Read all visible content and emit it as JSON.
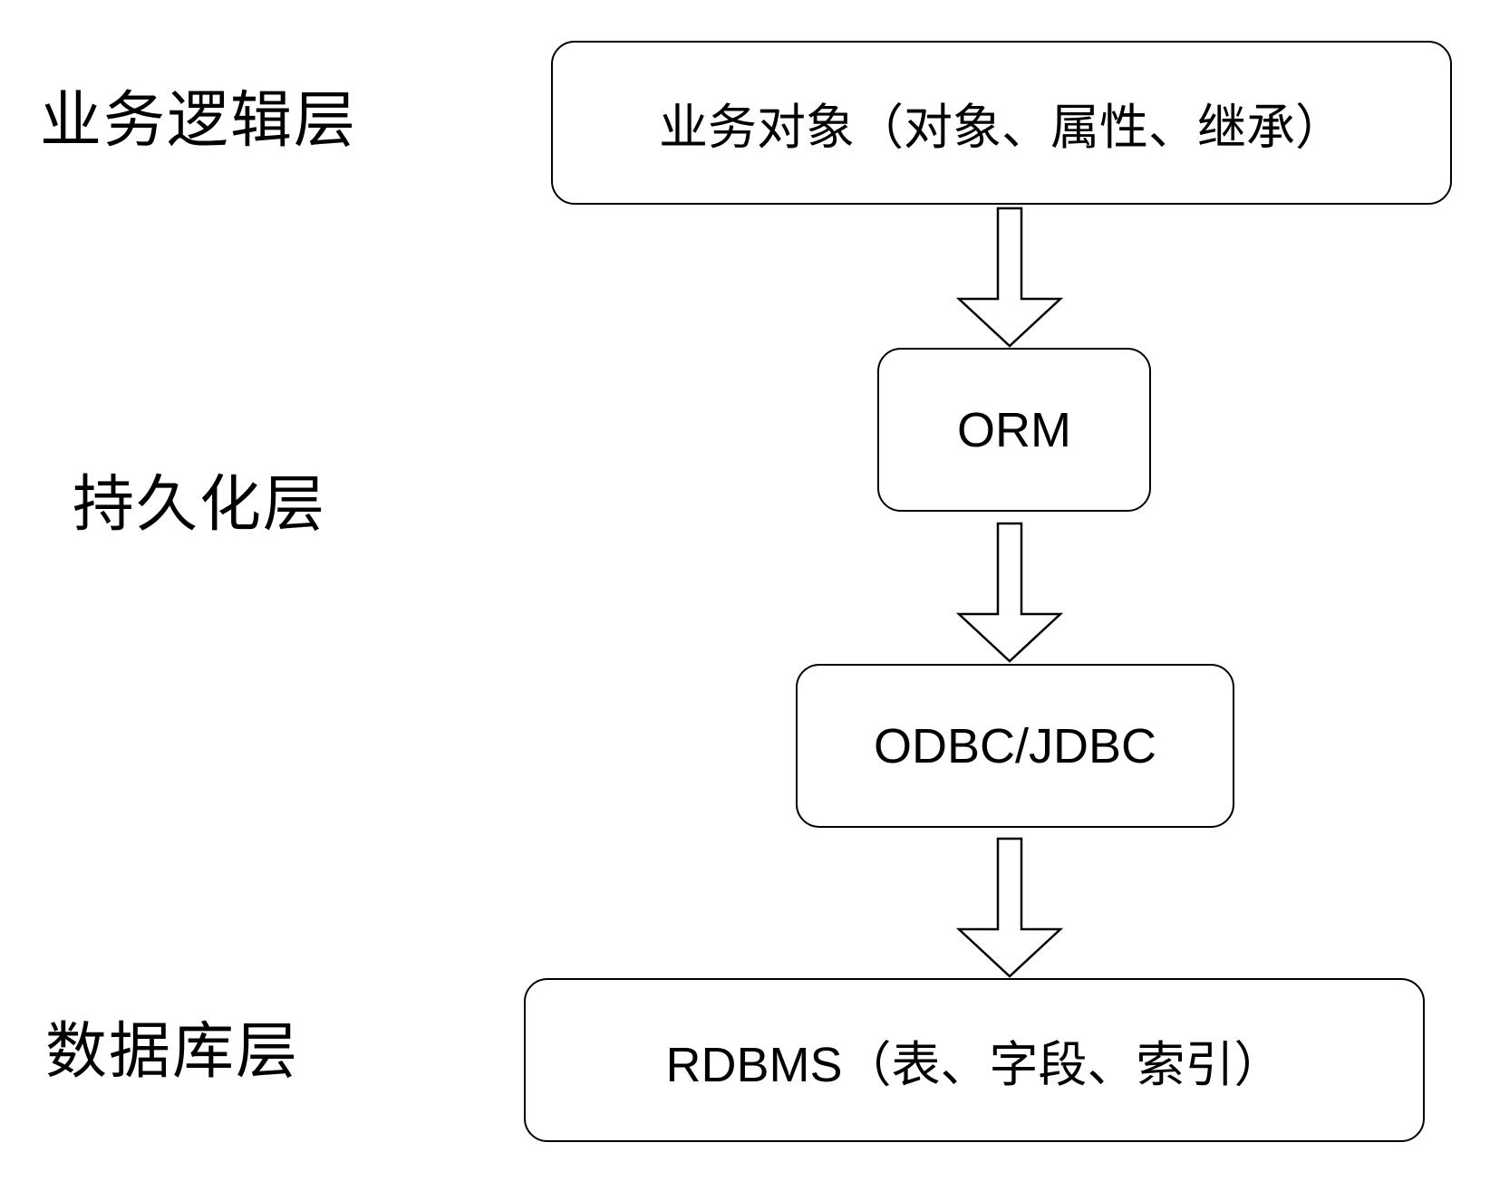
{
  "layers": {
    "business": "业务逻辑层",
    "persistence": "持久化层",
    "database": "数据库层"
  },
  "boxes": {
    "business_objects": "业务对象（对象、属性、继承）",
    "orm": "ORM",
    "odbc_jdbc": "ODBC/JDBC",
    "rdbms": "RDBMS（表、字段、索引）"
  },
  "colors": {
    "stroke": "#000000",
    "fill": "#ffffff"
  }
}
